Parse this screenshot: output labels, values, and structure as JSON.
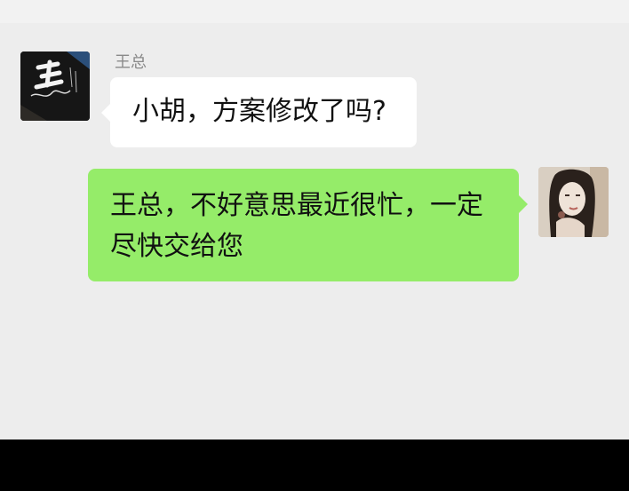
{
  "chat": {
    "messages": [
      {
        "side": "left",
        "sender": "王总",
        "avatar": "calligraphy-avatar-icon",
        "lines": [
          "小胡，方案修改了吗?"
        ]
      },
      {
        "side": "right",
        "sender": "",
        "avatar": "portrait-avatar-icon",
        "lines": [
          "王总，不好意思最近很忙，一定",
          "尽快交给您"
        ]
      }
    ]
  },
  "colors": {
    "chat_background": "#ededed",
    "incoming_bubble": "#ffffff",
    "outgoing_bubble": "#95ec69",
    "sender_name": "#8a8a8a",
    "footer_bar": "#000000"
  }
}
